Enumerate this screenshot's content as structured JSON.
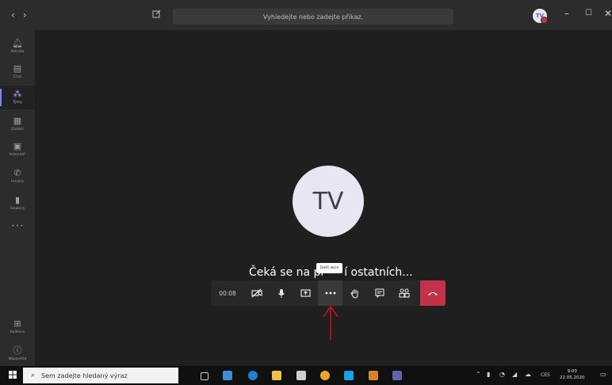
{
  "topbar": {
    "nav_back": "‹",
    "nav_forward": "›",
    "compose_icon": "edit-icon",
    "search_placeholder": "Vyhledejte nebo zadejte příkaz.",
    "avatar_initials": "TV",
    "minimize": "–",
    "maximize": "☐",
    "close": "✕"
  },
  "rail": {
    "items": [
      {
        "label": "Aktivita",
        "icon": "bell-icon"
      },
      {
        "label": "Chat",
        "icon": "chat-icon"
      },
      {
        "label": "Týmy",
        "icon": "teams-icon"
      },
      {
        "label": "Zadání",
        "icon": "assignments-icon"
      },
      {
        "label": "Kalendář",
        "icon": "calendar-icon"
      },
      {
        "label": "Hovory",
        "icon": "phone-icon"
      },
      {
        "label": "Soubory",
        "icon": "files-icon"
      }
    ],
    "more": "• • •",
    "bottom_items": [
      {
        "label": "Aplikace",
        "icon": "apps-icon"
      },
      {
        "label": "Nápověda",
        "icon": "help-icon"
      }
    ]
  },
  "stage": {
    "avatar_initials": "TV",
    "waiting_text_left": "Čeká se na př",
    "waiting_text_right": "í ostatních...",
    "tooltip": "Další akce"
  },
  "callbar": {
    "timer": "00:08",
    "buttons": [
      "camera-off-icon",
      "mic-icon",
      "share-screen-icon",
      "more-actions-icon",
      "raise-hand-icon",
      "chat-icon",
      "participants-icon"
    ],
    "hangup_icon": "hang-up-icon"
  },
  "taskbar": {
    "search_placeholder": "Sem zadejte hledaný výraz",
    "language": "CES",
    "time": "9:00",
    "date": "22.05.2020"
  },
  "colors": {
    "accent": "#7f85f5",
    "hangup": "#c4314b",
    "annotation_arrow": "#c0141c"
  }
}
